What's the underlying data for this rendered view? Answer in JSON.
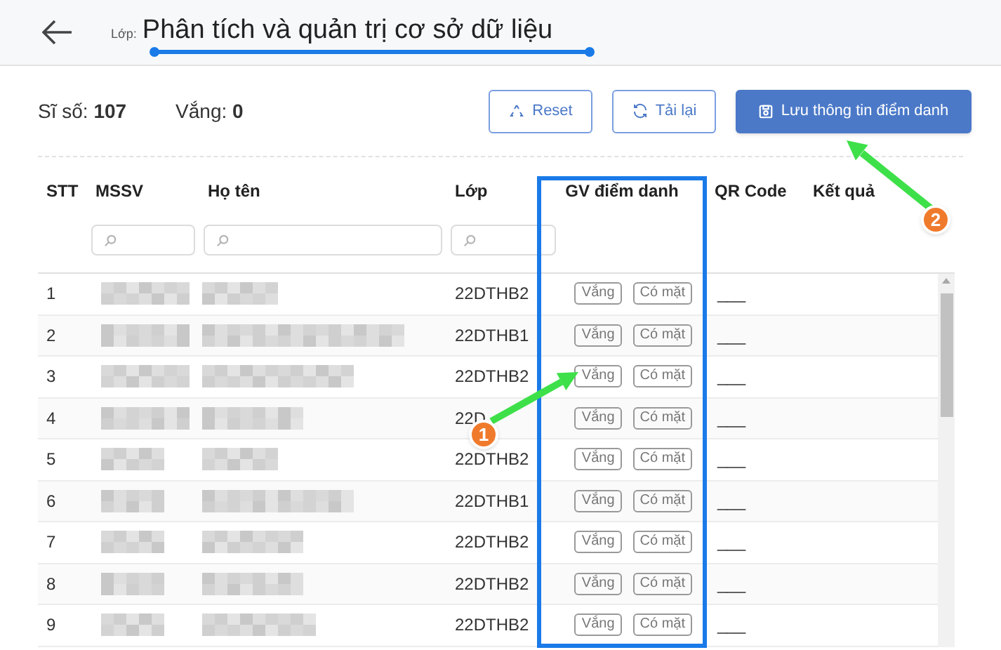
{
  "header": {
    "class_label": "Lớp:",
    "title": "Phân tích và quản trị cơ sở dữ liệu"
  },
  "stats": [
    {
      "label": "Sĩ số:",
      "value": "107"
    },
    {
      "label": "Vắng:",
      "value": "0"
    }
  ],
  "buttons": [
    {
      "label": "Reset",
      "kind": "reset",
      "primary": false
    },
    {
      "label": "Tải lại",
      "kind": "reload",
      "primary": false
    },
    {
      "label": "Lưu thông tin điểm danh",
      "kind": "save",
      "primary": true
    }
  ],
  "table": {
    "columns": [
      "STT",
      "MSSV",
      "Họ tên",
      "Lớp",
      "GV điểm danh",
      "QR Code",
      "Kết quả"
    ],
    "rows": [
      {
        "stt": "1",
        "lop": "22DTHB2",
        "absent": "Vắng",
        "present": "Có mặt",
        "qr": "___"
      },
      {
        "stt": "2",
        "lop": "22DTHB1",
        "absent": "Vắng",
        "present": "Có mặt",
        "qr": "___"
      },
      {
        "stt": "3",
        "lop": "22DTHB2",
        "absent": "Vắng",
        "present": "Có mặt",
        "qr": "___"
      },
      {
        "stt": "4",
        "lop": "22D",
        "absent": "Vắng",
        "present": "Có mặt",
        "qr": "___"
      },
      {
        "stt": "5",
        "lop": "22DTHB2",
        "absent": "Vắng",
        "present": "Có mặt",
        "qr": "___"
      },
      {
        "stt": "6",
        "lop": "22DTHB1",
        "absent": "Vắng",
        "present": "Có mặt",
        "qr": "___"
      },
      {
        "stt": "7",
        "lop": "22DTHB2",
        "absent": "Vắng",
        "present": "Có mặt",
        "qr": "___"
      },
      {
        "stt": "8",
        "lop": "22DTHB2",
        "absent": "Vắng",
        "present": "Có mặt",
        "qr": "___"
      },
      {
        "stt": "9",
        "lop": "22DTHB2",
        "absent": "Vắng",
        "present": "Có mặt",
        "qr": "___"
      }
    ]
  },
  "annotations": [
    {
      "label": "1"
    },
    {
      "label": "2"
    }
  ]
}
